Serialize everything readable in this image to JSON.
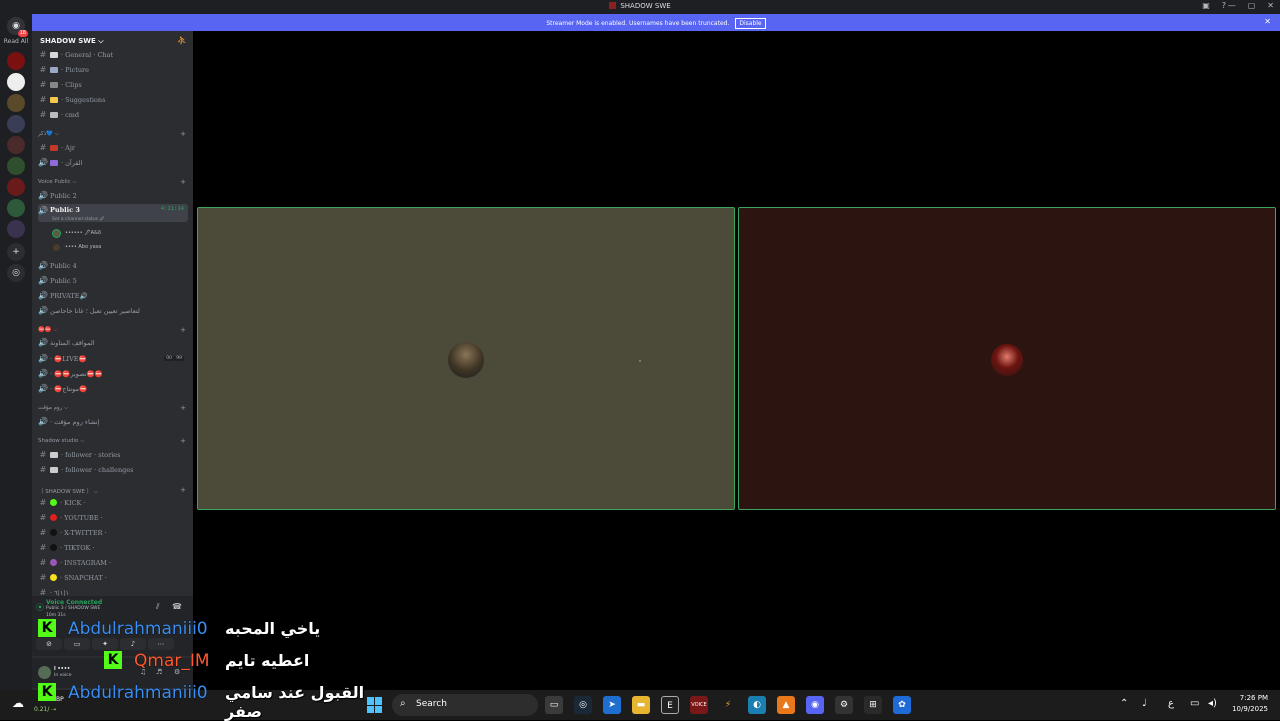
{
  "window": {
    "title": "SHADOW SWE"
  },
  "banner": {
    "message": "Streamer Mode is enabled. Usernames have been truncated.",
    "disable_label": "Disable"
  },
  "server_rail": {
    "read_all": "Read All",
    "badge_count": "18"
  },
  "guild": {
    "name": "SHADOW SWE ⌵"
  },
  "channels": {
    "general": "· General · Chat",
    "picture": "· Picture",
    "clips": "· Clips",
    "suggestions": "· Suggestions",
    "cmd": "· cmd",
    "cat_quran": "ذكر💙 ⌵",
    "ajr": "· Ajr",
    "quran": "· القرآن",
    "cat_voice_public": "Voice Public ⌵",
    "public2": "Public 2",
    "public3": "Public 3",
    "public3_time": "4:11:14",
    "public3_status": "Set a channel status 🖉",
    "voice_user1": "•••••• 🖋A&δ",
    "voice_user2": "•••• Abo yasa",
    "public4": "Public 4",
    "public5": "Public 5",
    "private": "PRIVATE🔊",
    "temp_room": "لتعاصير تعيين تعبل ؛ غانا حاحاصن",
    "cat_red": "⛔⛔ ⌵",
    "rules_room": "المواقف المتاونة",
    "live": "· ⛔LIVE⛔",
    "live_pill_a": "00",
    "live_pill_b": "99",
    "photo": "· ⛔⛔تصوير⛔⛔",
    "montage": "· ⛔مونتاج⛔",
    "cat_temp": "روم مؤقت ⌵",
    "create_temp": "· إنشاء روم مؤقت",
    "cat_studio": "Shadow studio ⌵",
    "stories": "· follower · stories",
    "challenges": "· follower · challenges",
    "cat_social": "〔 SHADOW SWE 〕 ⌵",
    "kick": "· KICK ·",
    "youtube": "· YOUTUBE ·",
    "twitter": "· X-TWITTER ·",
    "tiktok": "· TIKTOK ·",
    "instagram": "· INSTAGRAM ·",
    "snapchat": "· SNAPCHAT ·",
    "last": "· ١|١|٦"
  },
  "voice_panel": {
    "title": "Voice Connected",
    "channel": "Public 3 / SHADOW SWE",
    "elapsed": "10m 31s"
  },
  "user_panel": {
    "name": "l ••••",
    "status": "In voice"
  },
  "chat_overlay": [
    {
      "user": "Abdulrahmaniii0",
      "message": "ياخي المحبه",
      "user_color": "#3a8ff5"
    },
    {
      "user": "Qmar_IM",
      "message": "اعطيه تايم",
      "user_color": "#ff5a2e"
    },
    {
      "user": "Abdulrahmaniii0",
      "message": "القبول عند سامي صفر",
      "user_color": "#3a8ff5"
    }
  ],
  "taskbar": {
    "weather_label": "BP",
    "weather_temp": "0.21/ ⇢",
    "search_placeholder": "Search",
    "lang": "ع",
    "time": "7:26 PM",
    "date": "10/9/2025"
  },
  "colors": {
    "banner": "#5865f2",
    "voice_green": "#23a55a",
    "kick_green": "#53fc18"
  }
}
